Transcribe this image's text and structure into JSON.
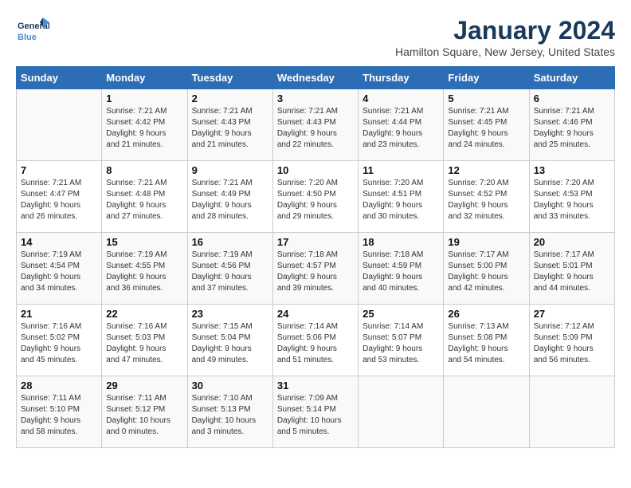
{
  "header": {
    "logo_general": "General",
    "logo_blue": "Blue",
    "title": "January 2024",
    "subtitle": "Hamilton Square, New Jersey, United States"
  },
  "days_of_week": [
    "Sunday",
    "Monday",
    "Tuesday",
    "Wednesday",
    "Thursday",
    "Friday",
    "Saturday"
  ],
  "weeks": [
    [
      {
        "day": "",
        "info": ""
      },
      {
        "day": "1",
        "info": "Sunrise: 7:21 AM\nSunset: 4:42 PM\nDaylight: 9 hours\nand 21 minutes."
      },
      {
        "day": "2",
        "info": "Sunrise: 7:21 AM\nSunset: 4:43 PM\nDaylight: 9 hours\nand 21 minutes."
      },
      {
        "day": "3",
        "info": "Sunrise: 7:21 AM\nSunset: 4:43 PM\nDaylight: 9 hours\nand 22 minutes."
      },
      {
        "day": "4",
        "info": "Sunrise: 7:21 AM\nSunset: 4:44 PM\nDaylight: 9 hours\nand 23 minutes."
      },
      {
        "day": "5",
        "info": "Sunrise: 7:21 AM\nSunset: 4:45 PM\nDaylight: 9 hours\nand 24 minutes."
      },
      {
        "day": "6",
        "info": "Sunrise: 7:21 AM\nSunset: 4:46 PM\nDaylight: 9 hours\nand 25 minutes."
      }
    ],
    [
      {
        "day": "7",
        "info": "Sunrise: 7:21 AM\nSunset: 4:47 PM\nDaylight: 9 hours\nand 26 minutes."
      },
      {
        "day": "8",
        "info": "Sunrise: 7:21 AM\nSunset: 4:48 PM\nDaylight: 9 hours\nand 27 minutes."
      },
      {
        "day": "9",
        "info": "Sunrise: 7:21 AM\nSunset: 4:49 PM\nDaylight: 9 hours\nand 28 minutes."
      },
      {
        "day": "10",
        "info": "Sunrise: 7:20 AM\nSunset: 4:50 PM\nDaylight: 9 hours\nand 29 minutes."
      },
      {
        "day": "11",
        "info": "Sunrise: 7:20 AM\nSunset: 4:51 PM\nDaylight: 9 hours\nand 30 minutes."
      },
      {
        "day": "12",
        "info": "Sunrise: 7:20 AM\nSunset: 4:52 PM\nDaylight: 9 hours\nand 32 minutes."
      },
      {
        "day": "13",
        "info": "Sunrise: 7:20 AM\nSunset: 4:53 PM\nDaylight: 9 hours\nand 33 minutes."
      }
    ],
    [
      {
        "day": "14",
        "info": "Sunrise: 7:19 AM\nSunset: 4:54 PM\nDaylight: 9 hours\nand 34 minutes."
      },
      {
        "day": "15",
        "info": "Sunrise: 7:19 AM\nSunset: 4:55 PM\nDaylight: 9 hours\nand 36 minutes."
      },
      {
        "day": "16",
        "info": "Sunrise: 7:19 AM\nSunset: 4:56 PM\nDaylight: 9 hours\nand 37 minutes."
      },
      {
        "day": "17",
        "info": "Sunrise: 7:18 AM\nSunset: 4:57 PM\nDaylight: 9 hours\nand 39 minutes."
      },
      {
        "day": "18",
        "info": "Sunrise: 7:18 AM\nSunset: 4:59 PM\nDaylight: 9 hours\nand 40 minutes."
      },
      {
        "day": "19",
        "info": "Sunrise: 7:17 AM\nSunset: 5:00 PM\nDaylight: 9 hours\nand 42 minutes."
      },
      {
        "day": "20",
        "info": "Sunrise: 7:17 AM\nSunset: 5:01 PM\nDaylight: 9 hours\nand 44 minutes."
      }
    ],
    [
      {
        "day": "21",
        "info": "Sunrise: 7:16 AM\nSunset: 5:02 PM\nDaylight: 9 hours\nand 45 minutes."
      },
      {
        "day": "22",
        "info": "Sunrise: 7:16 AM\nSunset: 5:03 PM\nDaylight: 9 hours\nand 47 minutes."
      },
      {
        "day": "23",
        "info": "Sunrise: 7:15 AM\nSunset: 5:04 PM\nDaylight: 9 hours\nand 49 minutes."
      },
      {
        "day": "24",
        "info": "Sunrise: 7:14 AM\nSunset: 5:06 PM\nDaylight: 9 hours\nand 51 minutes."
      },
      {
        "day": "25",
        "info": "Sunrise: 7:14 AM\nSunset: 5:07 PM\nDaylight: 9 hours\nand 53 minutes."
      },
      {
        "day": "26",
        "info": "Sunrise: 7:13 AM\nSunset: 5:08 PM\nDaylight: 9 hours\nand 54 minutes."
      },
      {
        "day": "27",
        "info": "Sunrise: 7:12 AM\nSunset: 5:09 PM\nDaylight: 9 hours\nand 56 minutes."
      }
    ],
    [
      {
        "day": "28",
        "info": "Sunrise: 7:11 AM\nSunset: 5:10 PM\nDaylight: 9 hours\nand 58 minutes."
      },
      {
        "day": "29",
        "info": "Sunrise: 7:11 AM\nSunset: 5:12 PM\nDaylight: 10 hours\nand 0 minutes."
      },
      {
        "day": "30",
        "info": "Sunrise: 7:10 AM\nSunset: 5:13 PM\nDaylight: 10 hours\nand 3 minutes."
      },
      {
        "day": "31",
        "info": "Sunrise: 7:09 AM\nSunset: 5:14 PM\nDaylight: 10 hours\nand 5 minutes."
      },
      {
        "day": "",
        "info": ""
      },
      {
        "day": "",
        "info": ""
      },
      {
        "day": "",
        "info": ""
      }
    ]
  ]
}
